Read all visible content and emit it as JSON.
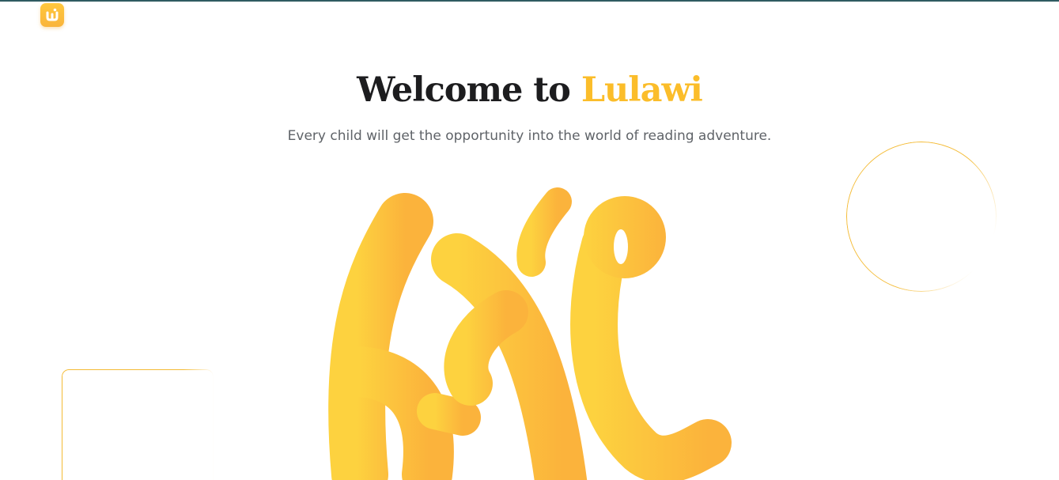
{
  "header": {
    "logo_glyph": "Ú",
    "logo_icon": "lulawi-logo-icon"
  },
  "hero": {
    "title_prefix": "Welcome to ",
    "title_brand": "Lulawi",
    "subtitle": "Every child will get the opportunity into the world of reading adventure."
  },
  "illustration": {
    "icon": "amharic-lettering-illustration"
  },
  "colors": {
    "brand": "#fbbd2a",
    "title": "#1d1d1f",
    "subtitle": "#5f6368",
    "top_border": "#2f5b61"
  }
}
